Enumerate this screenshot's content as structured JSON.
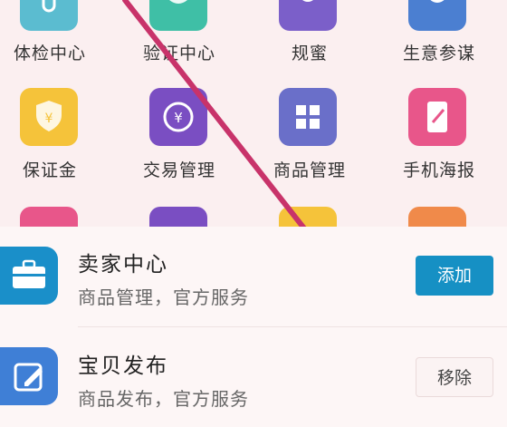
{
  "grid": {
    "apps": [
      {
        "label": "体检中心",
        "icon": "health-check-icon",
        "color": "#5bbcd0"
      },
      {
        "label": "验证中心",
        "icon": "shield-verify-icon",
        "color": "#3fbfa6"
      },
      {
        "label": "规蜜",
        "icon": "rules-icon",
        "color": "#7b5fc9"
      },
      {
        "label": "生意参谋",
        "icon": "compass-icon",
        "color": "#4b7fd1"
      },
      {
        "label": "保证金",
        "icon": "deposit-shield-icon",
        "color": "#f5c33a"
      },
      {
        "label": "交易管理",
        "icon": "yuan-exchange-icon",
        "color": "#7a4ec2"
      },
      {
        "label": "商品管理",
        "icon": "grid-box-icon",
        "color": "#6a6fc9"
      },
      {
        "label": "手机海报",
        "icon": "phone-poster-icon",
        "color": "#e8568a"
      }
    ],
    "partial_row_colors": [
      "#e8568a",
      "#7a4ec2",
      "#f5c33a",
      "#f08a4a"
    ]
  },
  "list": {
    "items": [
      {
        "title": "卖家中心",
        "subtitle": "商品管理，官方服务",
        "button": "添加",
        "icon": "briefcase-icon",
        "color": "#1a8fc9"
      },
      {
        "title": "宝贝发布",
        "subtitle": "商品发布，官方服务",
        "button": "移除",
        "icon": "edit-icon",
        "color": "#3f7fd6"
      }
    ]
  },
  "annotation_color": "#c8336a"
}
